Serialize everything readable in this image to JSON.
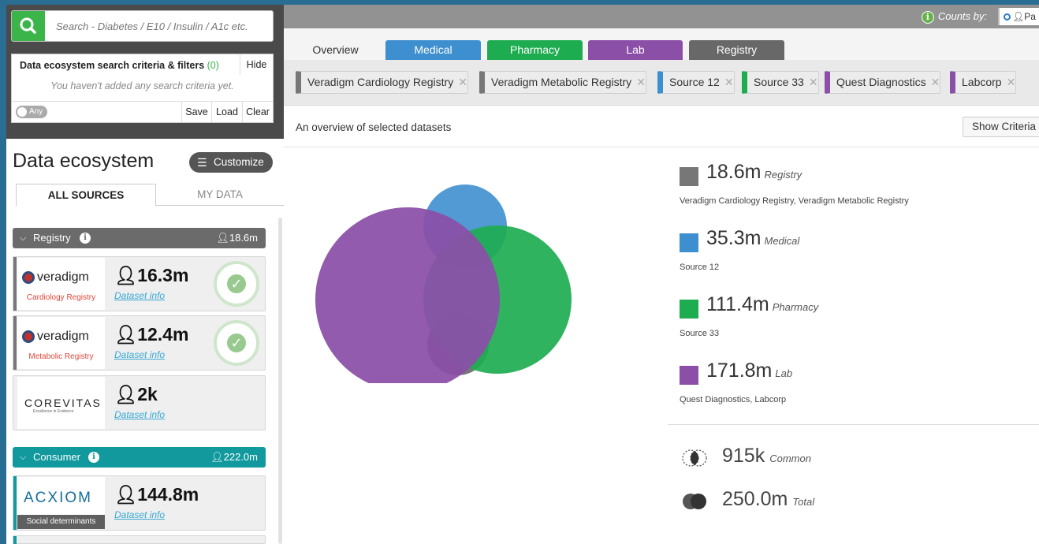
{
  "search": {
    "placeholder": "Search - Diabetes / E10 / Insulin / A1c etc."
  },
  "criteria": {
    "title": "Data ecosystem search criteria & filters",
    "count": "(0)",
    "hide_label": "Hide",
    "empty_text": "You haven't added any search criteria yet.",
    "any_label": "Any",
    "save_label": "Save",
    "load_label": "Load",
    "clear_label": "Clear"
  },
  "ecosystem": {
    "title": "Data ecosystem",
    "customize_label": "Customize",
    "tabs": [
      "ALL SOURCES",
      "MY DATA"
    ],
    "groups": {
      "registry": {
        "name": "Registry",
        "count": "18.6m"
      },
      "consumer": {
        "name": "Consumer",
        "count": "222.0m"
      }
    },
    "cards": {
      "cardio": {
        "logo": "veradigm",
        "sub": "Cardiology Registry",
        "count": "16.3m",
        "link": "Dataset info"
      },
      "metab": {
        "logo": "veradigm",
        "sub": "Metabolic Registry",
        "count": "12.4m",
        "link": "Dataset info"
      },
      "corev": {
        "logo": "COREVITAS",
        "sub": "Excellence in Evidence",
        "count": "2k",
        "link": "Dataset info"
      },
      "acxiom": {
        "logo": "ACXIOM",
        "sub": "Social determinants",
        "count": "144.8m",
        "link": "Dataset info"
      }
    }
  },
  "topbar": {
    "counts_by_label": "Counts by:",
    "toggle_label": "Pa"
  },
  "main": {
    "tabs": {
      "overview": "Overview",
      "medical": "Medical",
      "pharmacy": "Pharmacy",
      "lab": "Lab",
      "registry": "Registry"
    },
    "chips": [
      {
        "label": "Veradigm Cardiology Registry",
        "color": "#777777"
      },
      {
        "label": "Veradigm Metabolic Registry",
        "color": "#777777"
      },
      {
        "label": "Source 12",
        "color": "#3e8fcf"
      },
      {
        "label": "Source 33",
        "color": "#1eac51"
      },
      {
        "label": "Quest Diagnostics",
        "color": "#8b4fa8"
      },
      {
        "label": "Labcorp",
        "color": "#8b4fa8"
      }
    ],
    "overview_label": "An overview of selected datasets",
    "show_criteria_label": "Show Criteria"
  },
  "stats": {
    "registry": {
      "value": "18.6m",
      "category": "Registry",
      "sources": "Veradigm Cardiology Registry, Veradigm Metabolic Registry",
      "color": "#777777"
    },
    "medical": {
      "value": "35.3m",
      "category": "Medical",
      "sources": "Source 12",
      "color": "#3e8fcf"
    },
    "pharmacy": {
      "value": "111.4m",
      "category": "Pharmacy",
      "sources": "Source 33",
      "color": "#1eac51"
    },
    "lab": {
      "value": "171.8m",
      "category": "Lab",
      "sources": "Quest Diagnostics, Labcorp",
      "color": "#8b4fa8"
    },
    "common": {
      "value": "915k",
      "category": "Common"
    },
    "total": {
      "value": "250.0m",
      "category": "Total"
    }
  },
  "colors": {
    "registry": "#777777",
    "medical": "#3e8fcf",
    "pharmacy": "#1eac51",
    "lab": "#8b4fa8",
    "consumer": "#11999e",
    "accent_green": "#3bb54a"
  }
}
